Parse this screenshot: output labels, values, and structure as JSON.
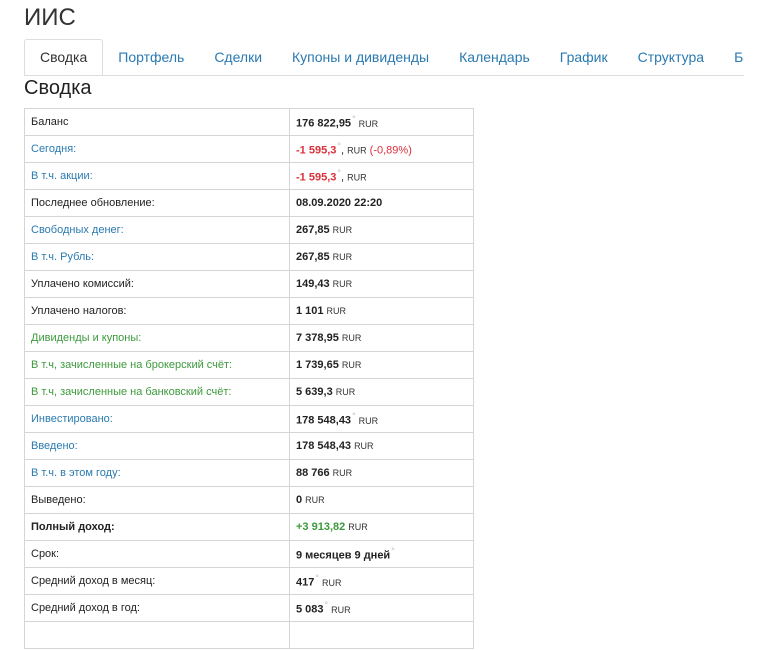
{
  "page_title": "ИИС",
  "tabs": [
    {
      "label": "Сводка",
      "active": true
    },
    {
      "label": "Портфель"
    },
    {
      "label": "Сделки"
    },
    {
      "label": "Купоны и дивиденды"
    },
    {
      "label": "Календарь"
    },
    {
      "label": "График"
    },
    {
      "label": "Структура"
    },
    {
      "label": "Бал"
    }
  ],
  "section_title": "Сводка",
  "colors": {
    "link": "#2a7ab0",
    "positive": "#3c9a3c",
    "negative": "#d9303b"
  },
  "rows": [
    {
      "label": "Баланс",
      "value": "176 822,95",
      "unit": "RUR"
    },
    {
      "label": "Сегодня:",
      "value": "-1 595,3",
      "sep": ", ",
      "unit": "RUR",
      "extra": "(-0,89%)"
    },
    {
      "label": "В т.ч. акции:",
      "value": "-1 595,3",
      "sep": ", ",
      "unit": "RUR"
    },
    {
      "label": "Последнее обновление:",
      "value": "08.09.2020 22:20"
    },
    {
      "label": "Свободных денег:",
      "value": "267,85",
      "unit": "RUR"
    },
    {
      "label": "В т.ч. Рубль:",
      "value": "267,85",
      "unit": "RUR"
    },
    {
      "label": "Уплачено комиссий:",
      "value": "149,43",
      "unit": "RUR"
    },
    {
      "label": "Уплачено налогов:",
      "value": "1 101",
      "unit": "RUR"
    },
    {
      "label": "Дивиденды и купоны:",
      "value": "7 378,95",
      "unit": "RUR"
    },
    {
      "label": "В т.ч, зачисленные на брокерский счёт:",
      "value": "1 739,65",
      "unit": "RUR"
    },
    {
      "label": "В т.ч, зачисленные на банковский счёт:",
      "value": "5 639,3",
      "unit": "RUR"
    },
    {
      "label": "Инвестировано:",
      "value": "178 548,43",
      "unit": "RUR"
    },
    {
      "label": "Введено:",
      "value": "178 548,43",
      "unit": "RUR"
    },
    {
      "label": "В т.ч. в этом году:",
      "value": "88 766",
      "unit": "RUR"
    },
    {
      "label": "Выведено:",
      "value": "0",
      "unit": "RUR"
    },
    {
      "label": "Полный доход:",
      "value": "+3 913,82",
      "unit": "RUR"
    },
    {
      "label": "Срок:",
      "value": "9 месяцев 9 дней"
    },
    {
      "label": "Средний доход в месяц:",
      "value": "417",
      "unit": "RUR"
    },
    {
      "label": "Средний доход в год:",
      "value": "5 083",
      "unit": "RUR"
    }
  ]
}
